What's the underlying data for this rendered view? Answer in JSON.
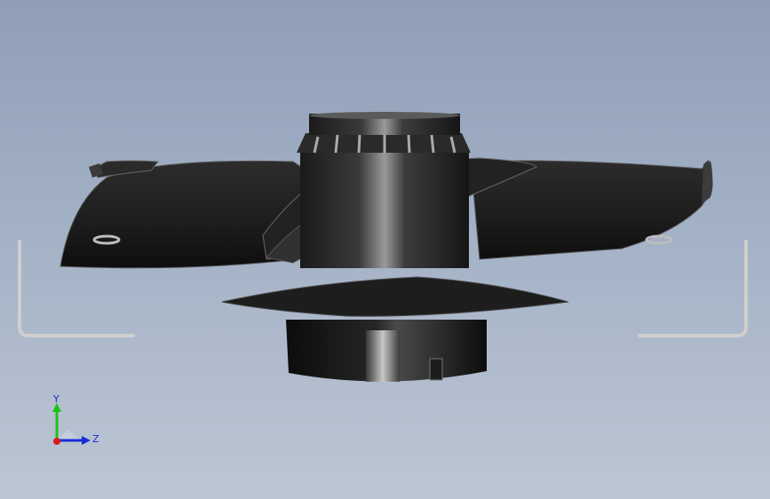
{
  "axes": {
    "y_label": "Y",
    "z_label": "Z",
    "colors": {
      "x": "#d81b1b",
      "y": "#19c219",
      "z": "#1b2bd8"
    }
  },
  "model": {
    "object": "axial-fan-with-guard",
    "view": "side"
  }
}
